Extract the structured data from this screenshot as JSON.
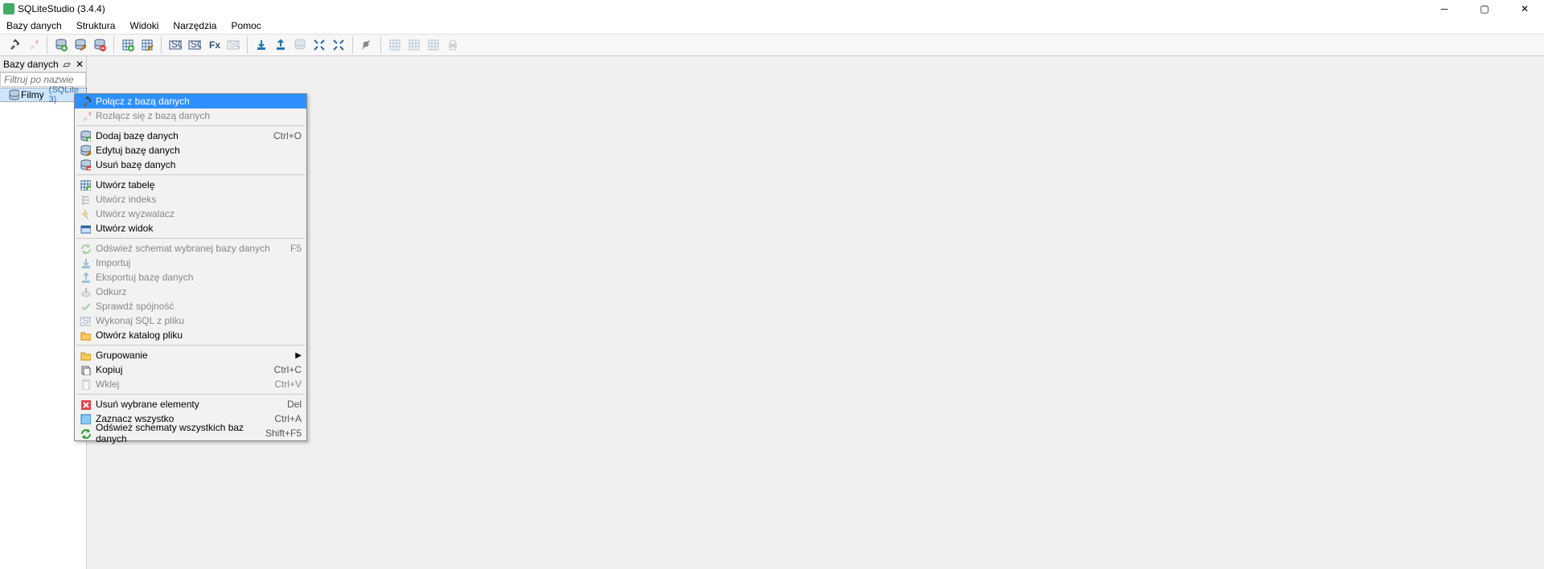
{
  "window": {
    "title": "SQLiteStudio (3.4.4)"
  },
  "menubar": [
    "Bazy danych",
    "Struktura",
    "Widoki",
    "Narzędzia",
    "Pomoc"
  ],
  "sidebar": {
    "panel_title": "Bazy danych",
    "filter_placeholder": "Filtruj po nazwie",
    "db": {
      "name": "Filmy",
      "type": "(SQLite 3)"
    }
  },
  "ctx": {
    "connect": "Połącz z bazą danych",
    "disconnect": "Rozłącz się z bazą danych",
    "add_db": "Dodaj bazę danych",
    "add_db_sc": "Ctrl+O",
    "edit_db": "Edytuj bazę danych",
    "del_db": "Usuń bazę danych",
    "create_table": "Utwórz tabelę",
    "create_index": "Utwórz indeks",
    "create_trigger": "Utwórz wyzwalacz",
    "create_view": "Utwórz widok",
    "refresh_schema": "Odśwież schemat wybranej bazy danych",
    "refresh_schema_sc": "F5",
    "import": "Importuj",
    "export_db": "Eksportuj bazę danych",
    "vacuum": "Odkurz",
    "integrity": "Sprawdź spójność",
    "exec_sql_file": "Wykonaj SQL z pliku",
    "open_folder": "Otwórz katalog pliku",
    "grouping": "Grupowanie",
    "copy": "Kopiuj",
    "copy_sc": "Ctrl+C",
    "paste": "Wklej",
    "paste_sc": "Ctrl+V",
    "del_selected": "Usuń wybrane elementy",
    "del_selected_sc": "Del",
    "select_all": "Zaznacz wszystko",
    "select_all_sc": "Ctrl+A",
    "refresh_all": "Odśwież schematy wszystkich baz danych",
    "refresh_all_sc": "Shift+F5"
  }
}
